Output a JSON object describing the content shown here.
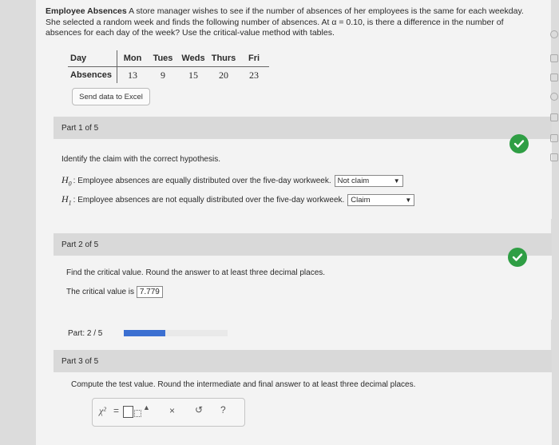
{
  "problem": {
    "title": "Employee Absences",
    "text_line1": "A store manager wishes to see if the number of absences of her employees is the same for each weekday.",
    "text_line2": "She selected a random week and finds the following number of absences. At α = 0.10, is there a difference in the number of",
    "text_line3": "absences for each day of the week? Use the critical-value method with tables."
  },
  "table": {
    "row1_label": "Day",
    "row2_label": "Absences",
    "days": [
      "Mon",
      "Tues",
      "Weds",
      "Thurs",
      "Fri"
    ],
    "absences": [
      "13",
      "9",
      "15",
      "20",
      "23"
    ]
  },
  "send_excel_label": "Send data to Excel",
  "part1": {
    "header": "Part 1 of 5",
    "instruction": "Identify the claim with the correct hypothesis.",
    "h0_sym": "H",
    "h0_sub": "0",
    "h0_text": ": Employee absences are equally distributed over the five-day workweek.",
    "h0_select": "Not claim",
    "h1_sym": "H",
    "h1_sub": "1",
    "h1_text": ": Employee absences are not equally distributed over the five-day workweek.",
    "h1_select": "Claim"
  },
  "part2": {
    "header": "Part 2 of 5",
    "instruction": "Find the critical value. Round the answer to at least three decimal places.",
    "crit_label": "The critical value is",
    "crit_value": "7.779"
  },
  "progress": {
    "label": "Part: 2 / 5",
    "fraction": 0.4
  },
  "part3": {
    "header": "Part 3 of 5",
    "instruction": "Compute the test value. Round the intermediate and final answer to at least three decimal places."
  },
  "toolbar": {
    "chi_label": "χ²",
    "equals": "=",
    "clear_icon": "×",
    "undo_icon": "↺",
    "help_icon": "?"
  },
  "colors": {
    "check_green": "#2f9e44",
    "progress_blue": "#3b6fd1"
  }
}
